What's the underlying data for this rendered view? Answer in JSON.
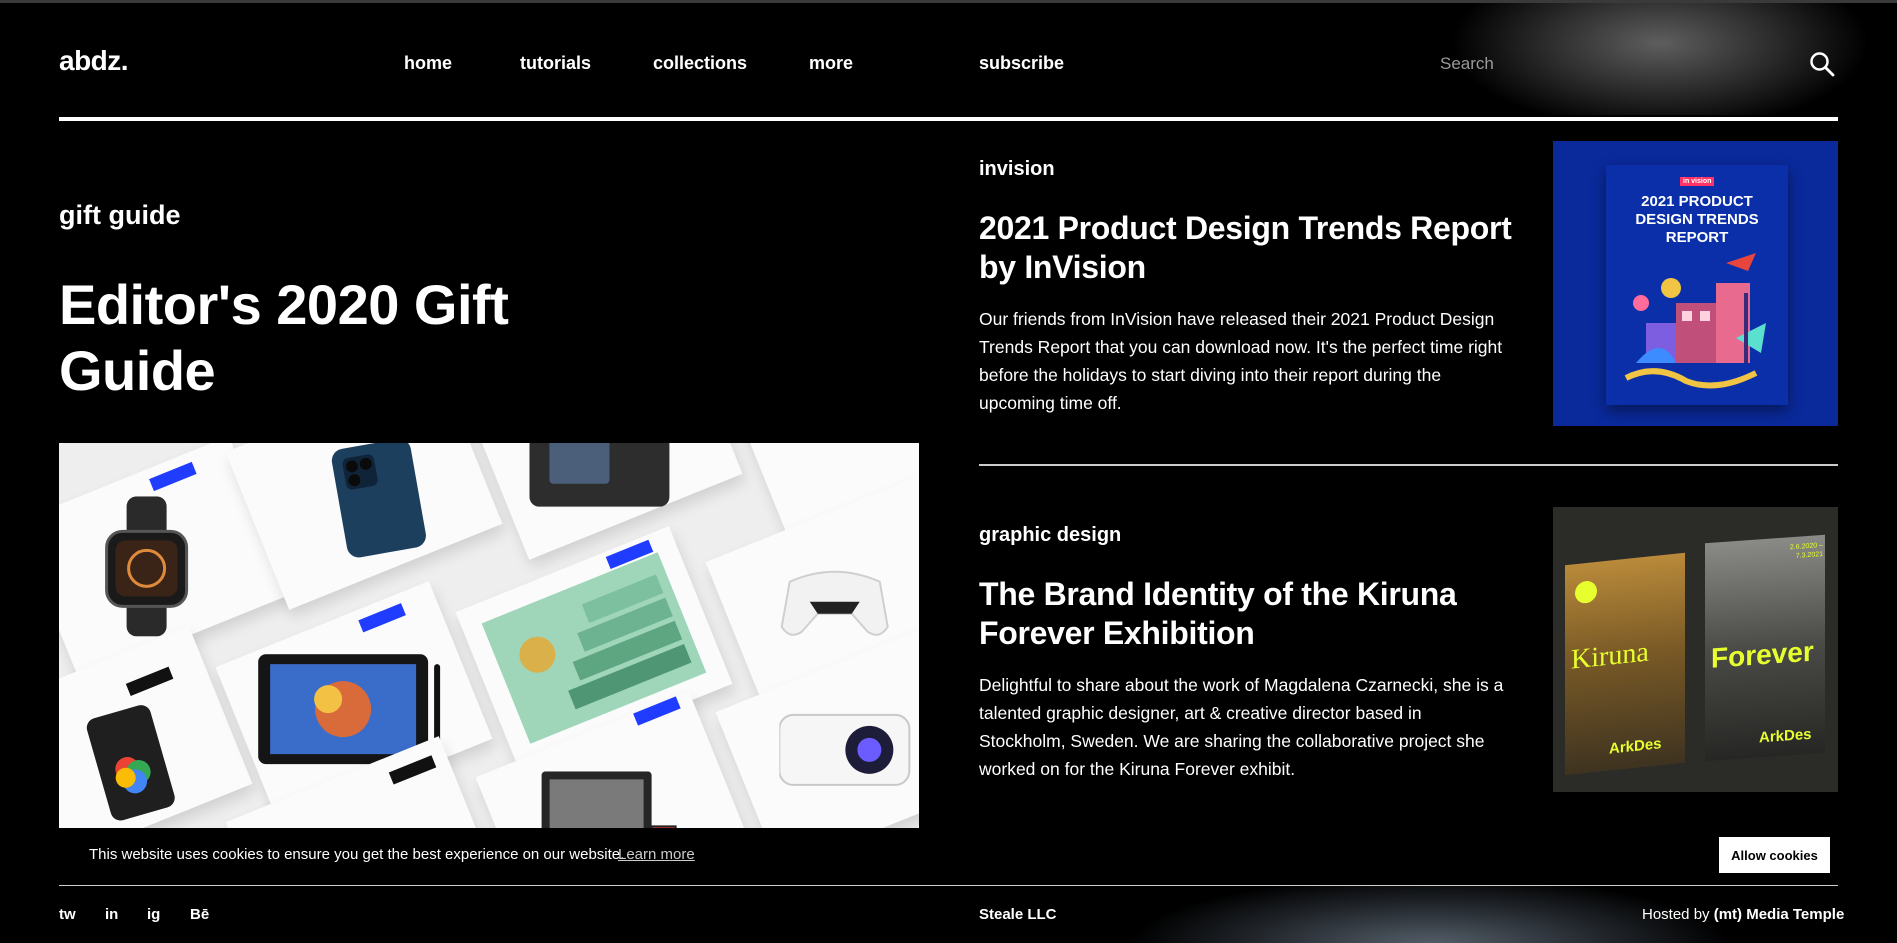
{
  "header": {
    "logo": "abdz.",
    "nav": {
      "home": "home",
      "tutorials": "tutorials",
      "collections": "collections",
      "more": "more",
      "subscribe": "subscribe"
    },
    "search_placeholder": "Search"
  },
  "hero": {
    "category": "gift guide",
    "title": "Editor's 2020 Gift Guide"
  },
  "articles": [
    {
      "category": "invision",
      "title": "2021 Product Design Trends Report by InVision",
      "description": "Our friends from InVision have released their 2021 Product Design Trends Report that you can download now. It's the perfect time right before the holidays to start diving into their report during the upcoming time off.",
      "thumb_title": "2021 PRODUCT DESIGN TRENDS REPORT",
      "thumb_logo": "in vision"
    },
    {
      "category": "graphic design",
      "title": "The Brand Identity of the Kiruna Forever Exhibition",
      "description": "Delightful to share about the work of Magdalena Czarnecki, she is a talented graphic designer, art & creative director based in Stockholm, Sweden. We are sharing the collaborative project she worked on for the Kiruna Forever exhibit.",
      "poster_left_word": "Kiruna",
      "poster_right_word": "Forever",
      "poster_brand": "ArkDes",
      "poster_dates": "2.6.2020 – 7.3.2021"
    }
  ],
  "cookie": {
    "message": "This website uses cookies to ensure you get the best experience on our website.",
    "learn_more": "Learn more",
    "allow_button": "Allow cookies"
  },
  "footer": {
    "social": {
      "twitter": "tw",
      "linkedin": "in",
      "instagram": "ig",
      "behance": "Bē"
    },
    "company": "Steale LLC",
    "hosted_prefix": "Hosted by",
    "host": "(mt) Media Temple"
  },
  "colors": {
    "background": "#000000",
    "text": "#ffffff",
    "invision_blue": "#0a2a9c",
    "badge_blue": "#1f3cff",
    "poster_yellow": "#e7ff2e"
  }
}
